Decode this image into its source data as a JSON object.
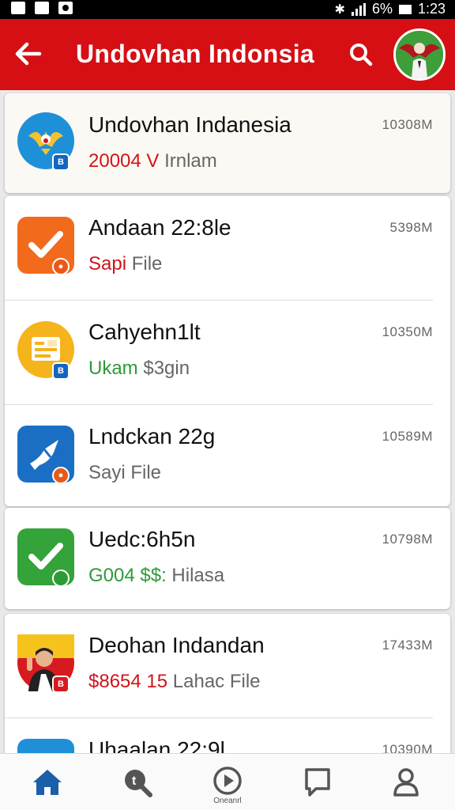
{
  "status_bar": {
    "battery": "6%",
    "time": "1:23"
  },
  "app_bar": {
    "title": "Undovhan Indonsia"
  },
  "items": [
    {
      "title": "Undovhan Indanesia",
      "size": "10308M",
      "sub_accent": "20004 V",
      "sub_rest": "Irnlam",
      "accent_color": "#d0141b",
      "icon": "garuda-icon",
      "icon_bg": "#1e90d8",
      "badge": "B"
    },
    {
      "title": "Andaan 22:8le",
      "size": "5398M",
      "sub_accent": "Sapi",
      "sub_rest": "File",
      "accent_color": "#d0141b",
      "icon": "checkmark-icon",
      "icon_bg": "#f26a1b",
      "badge": ""
    },
    {
      "title": "Cahyehn1lt",
      "size": "10350M",
      "sub_accent": "Ukam",
      "sub_rest": "$3gin",
      "accent_color": "#2e9a36",
      "icon": "document-icon",
      "icon_bg": "#f5b31c",
      "badge": "B"
    },
    {
      "title": "Lndckan 22g",
      "size": "10589M",
      "sub_accent": "",
      "sub_rest": "Sayi File",
      "accent_color": "#666666",
      "icon": "bird-icon",
      "icon_bg": "#1a6fc4",
      "badge": ""
    },
    {
      "title": "Uedc:6h5n",
      "size": "10798M",
      "sub_accent": "G004 $$:",
      "sub_rest": "Hilasa",
      "accent_color": "#2e9a36",
      "icon": "checkmark-icon",
      "icon_bg": "#34a339",
      "badge": "6"
    },
    {
      "title": "Deohan Indandan",
      "size": "17433M",
      "sub_accent": "$8654 15",
      "sub_rest": "Lahac File",
      "accent_color": "#d0141b",
      "icon": "person-icon",
      "icon_bg": "#d71920",
      "badge": "B"
    },
    {
      "title": "Uhaalan 22:9l",
      "size": "10390M",
      "sub_accent": "",
      "sub_rest": "",
      "accent_color": "#666666",
      "icon": "app-icon",
      "icon_bg": "#1e90d8",
      "badge": ""
    }
  ],
  "bottom_nav": {
    "center_label": "Oneanrl"
  },
  "colors": {
    "primary": "#d50f14",
    "nav_icon": "#555555",
    "home_active": "#1a5fa8"
  }
}
